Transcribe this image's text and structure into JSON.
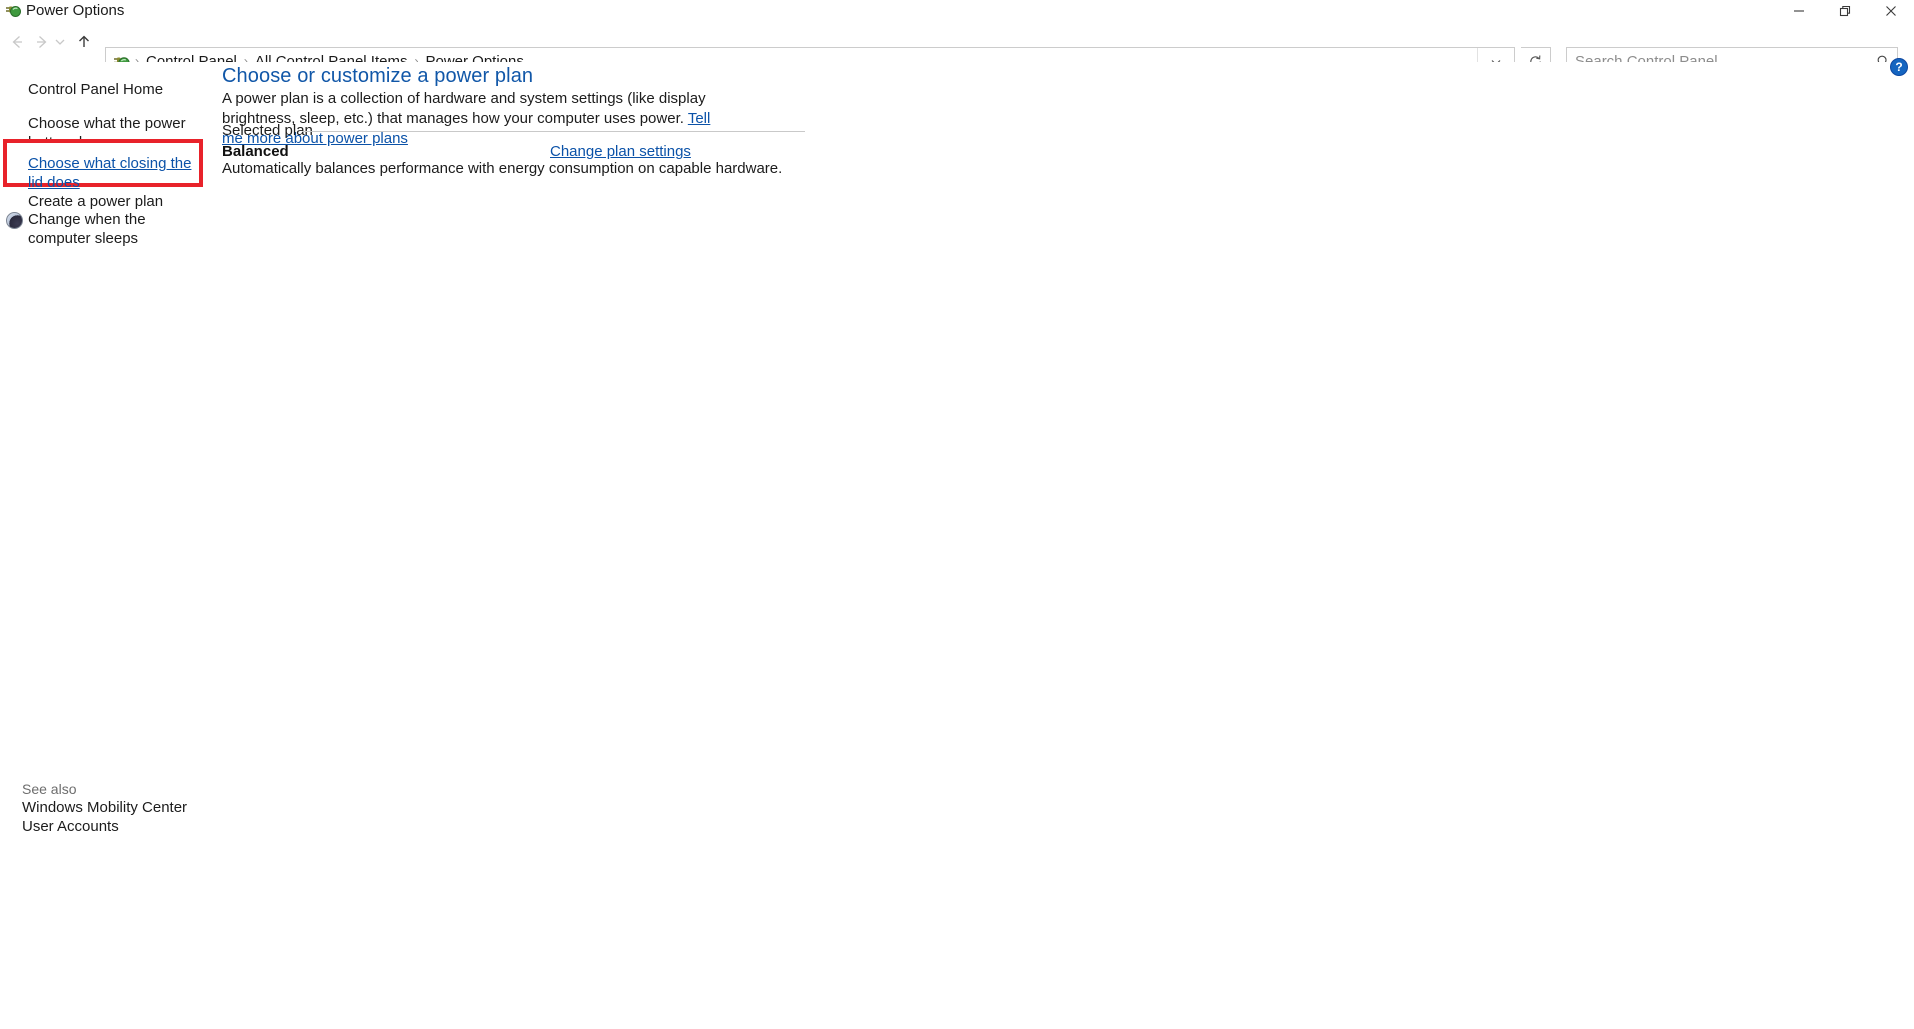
{
  "window": {
    "title": "Power Options",
    "icon": "power-plug-icon",
    "controls": {
      "minimize": "minimize-icon",
      "restore": "restore-icon",
      "close": "close-icon"
    }
  },
  "navbar": {
    "back": "back-arrow-icon",
    "forward": "forward-arrow-icon",
    "recent": "chevron-down-icon",
    "up": "up-arrow-icon",
    "address_icon": "power-plug-icon",
    "breadcrumbs": [
      "Control Panel",
      "All Control Panel Items",
      "Power Options"
    ],
    "separator": "›",
    "dropdown": "chevron-down-icon",
    "refresh": "refresh-icon"
  },
  "search": {
    "placeholder": "Search Control Panel",
    "value": "",
    "icon": "search-icon"
  },
  "sidebar": {
    "home": "Control Panel Home",
    "items": [
      {
        "label": "Choose what the power button does",
        "highlighted": false
      },
      {
        "label": "Choose what closing the lid does",
        "highlighted": true
      },
      {
        "label": "Create a power plan",
        "highlighted": false
      },
      {
        "label": "Change when the computer sleeps",
        "highlighted": false,
        "icon": "sleep-moon-icon"
      }
    ],
    "see_also_label": "See also",
    "see_also": [
      "Windows Mobility Center",
      "User Accounts"
    ],
    "highlight_color": "#e8222a"
  },
  "main": {
    "title": "Choose or customize a power plan",
    "intro_text": "A power plan is a collection of hardware and system settings (like display brightness, sleep, etc.) that manages how your computer uses power.",
    "intro_link": "Tell me more about power plans",
    "section_header": "Selected plan",
    "plan_name": "Balanced",
    "plan_description": "Automatically balances performance with energy consumption on capable hardware.",
    "change_plan_link": "Change plan settings",
    "help": "?",
    "link_color": "#0b52a8",
    "title_color": "#1157a8"
  }
}
